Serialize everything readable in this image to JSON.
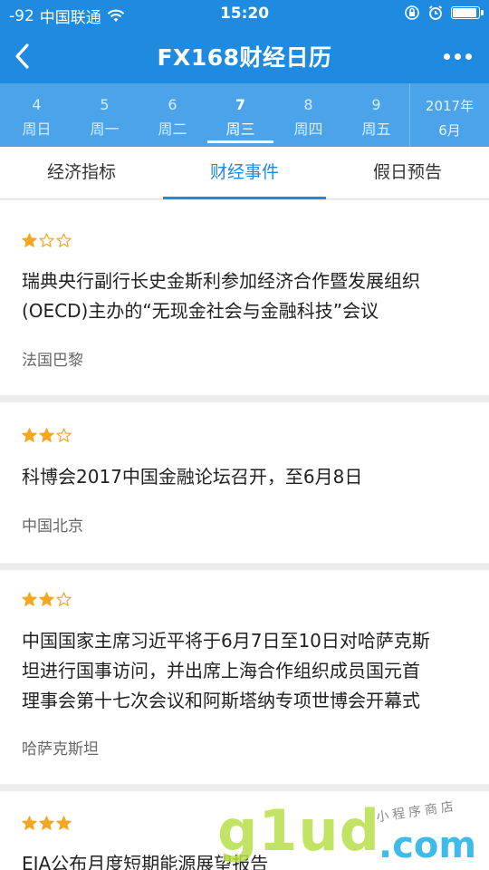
{
  "status_bar": {
    "signal": "-92",
    "carrier": "中国联通",
    "time": "15:20",
    "battery_level": 0.85
  },
  "nav": {
    "title": "FX168财经日历",
    "back_icon": "chevron-left-icon",
    "more_icon": "more-dots-icon"
  },
  "date_strip": {
    "days": [
      {
        "num": "4",
        "weekday": "周日"
      },
      {
        "num": "5",
        "weekday": "周一"
      },
      {
        "num": "6",
        "weekday": "周二"
      },
      {
        "num": "7",
        "weekday": "周三",
        "active": true
      },
      {
        "num": "8",
        "weekday": "周四"
      },
      {
        "num": "9",
        "weekday": "周五"
      }
    ],
    "year": "2017年",
    "month": "6月"
  },
  "tabs": [
    {
      "label": "经济指标"
    },
    {
      "label": "财经事件",
      "active": true
    },
    {
      "label": "假日预告"
    }
  ],
  "events": [
    {
      "stars": 1,
      "lines": [
        "瑞典央行副行长史金斯利参加经济合作暨发展组织",
        "(OECD)主办的“无现金社会与金融科技”会议"
      ],
      "location": "法国巴黎"
    },
    {
      "stars": 2,
      "lines": [
        "科博会2017中国金融论坛召开，至6月8日"
      ],
      "location": "中国北京"
    },
    {
      "stars": 2,
      "lines": [
        "中国国家主席习近平将于6月7日至10日对哈萨克斯",
        "坦进行国事访问，并出席上海合作组织成员国元首",
        "理事会第十七次会议和阿斯塔纳专项世博会开幕式"
      ],
      "location": "哈萨克斯坦"
    },
    {
      "stars": 3,
      "lines": [
        "EIA公布月度短期能源展望报告"
      ],
      "location": ""
    }
  ],
  "watermark": {
    "brand": "g1ud",
    "domain": ".com",
    "tagline": "小程序商店"
  },
  "colors": {
    "primary": "#1e8be0",
    "strip": "#4ba3ea",
    "star": "#f5a623"
  }
}
